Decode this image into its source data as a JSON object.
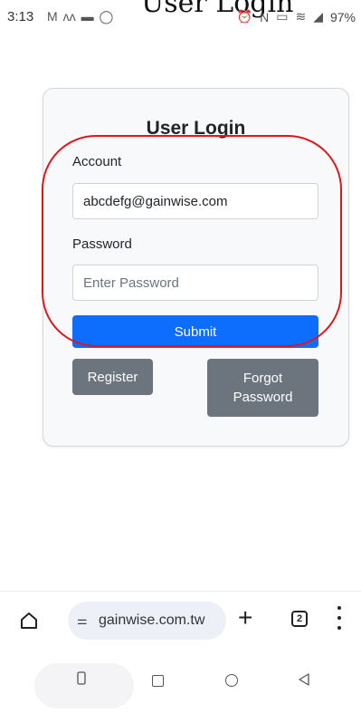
{
  "status_bar": {
    "time": "3:13",
    "left_icons": [
      "gmail-icon",
      "maps-icon",
      "message-icon",
      "whatsapp-icon"
    ],
    "right_icons": [
      "alarm-icon",
      "nfc-icon",
      "volte-icon",
      "wifi-icon",
      "signal-icon"
    ],
    "battery": "97%"
  },
  "page_title_overflow": "User Login",
  "login_card": {
    "title": "User Login",
    "account_label": "Account",
    "account_value": "abcdefg@gainwise.com",
    "password_label": "Password",
    "password_placeholder": "Enter Password",
    "submit_label": "Submit",
    "register_label": "Register",
    "forgot_label": "Forgot Password"
  },
  "browser_bar": {
    "url": "gainwise.com.tw",
    "tab_count": "2"
  },
  "colors": {
    "primary": "#0d6efd",
    "secondary": "#6c757d",
    "annotation": "#e0161b",
    "card_background": "#f8f9fa"
  }
}
